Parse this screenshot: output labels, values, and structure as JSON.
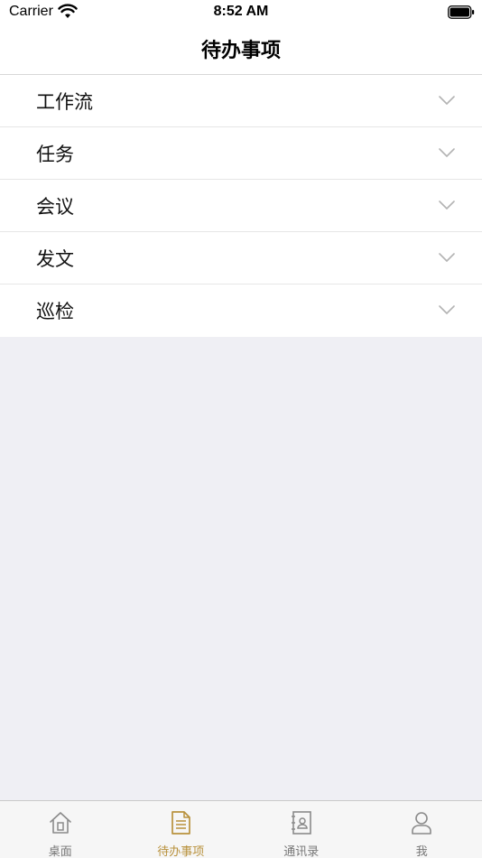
{
  "status_bar": {
    "carrier": "Carrier",
    "time": "8:52 AM"
  },
  "nav": {
    "title": "待办事项"
  },
  "list": {
    "items": [
      {
        "label": "工作流"
      },
      {
        "label": "任务"
      },
      {
        "label": "会议"
      },
      {
        "label": "发文"
      },
      {
        "label": "巡检"
      }
    ]
  },
  "tabbar": {
    "active_color": "#b8913c",
    "inactive_color": "#777777",
    "tabs": [
      {
        "label": "桌面",
        "icon": "home-icon",
        "active": false
      },
      {
        "label": "待办事项",
        "icon": "document-icon",
        "active": true
      },
      {
        "label": "通讯录",
        "icon": "contacts-book-icon",
        "active": false
      },
      {
        "label": "我",
        "icon": "person-icon",
        "active": false
      }
    ]
  }
}
